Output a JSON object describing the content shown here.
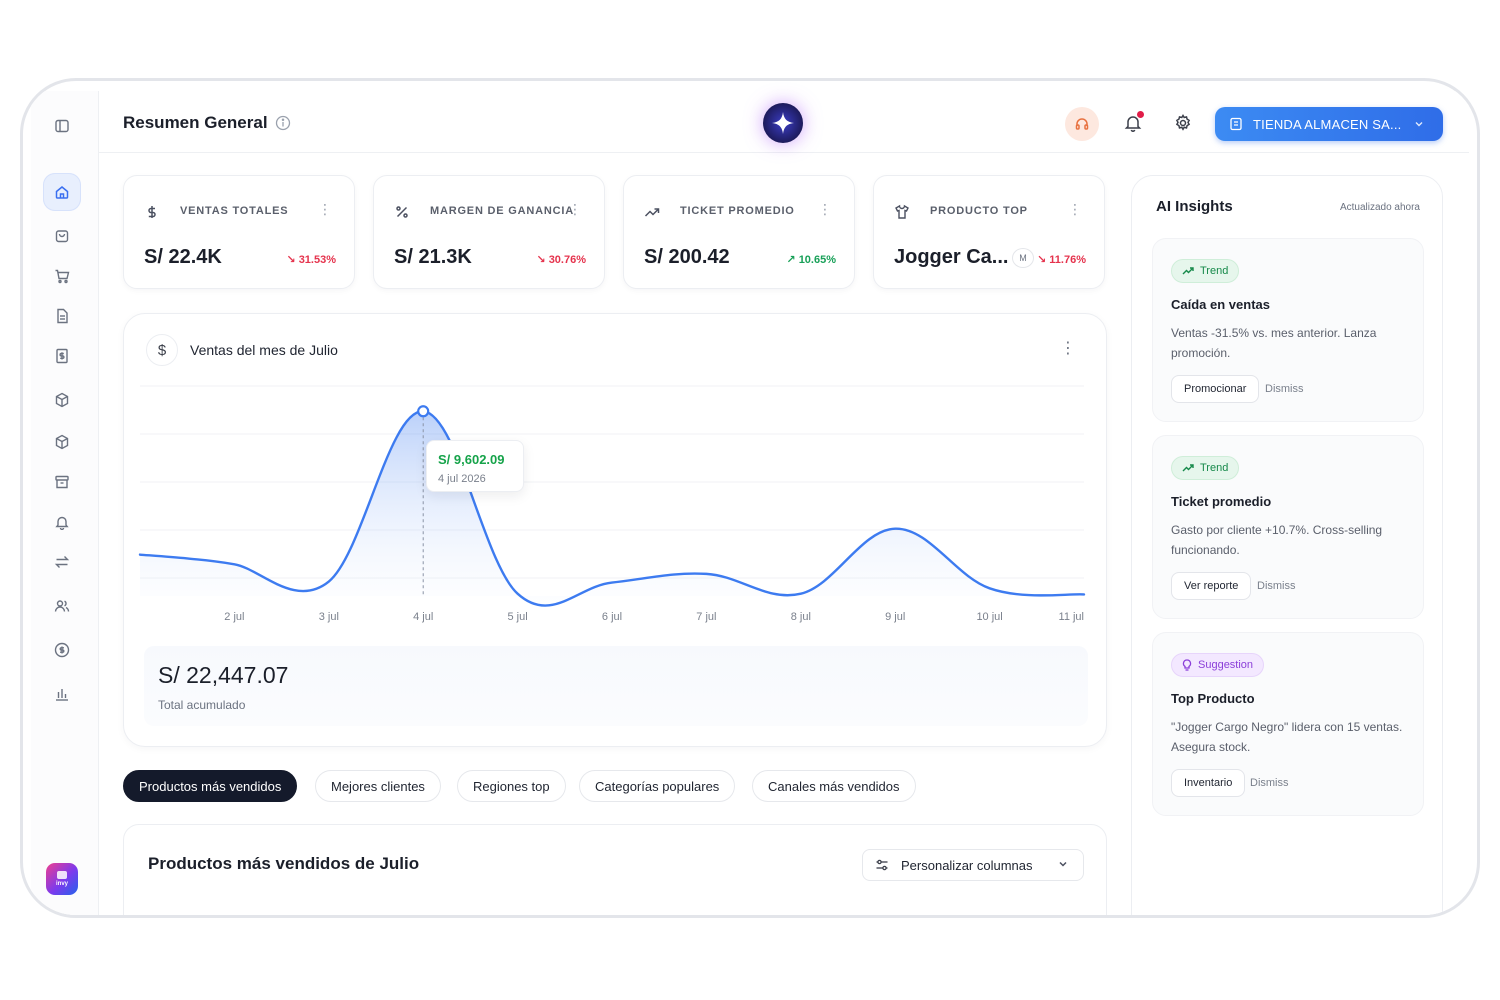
{
  "header": {
    "title": "Resumen General",
    "store_label": "TIENDA ALMACEN SA..."
  },
  "sidebar": {
    "items": [
      {
        "icon": "home-icon",
        "active": true
      },
      {
        "icon": "bag-icon"
      },
      {
        "icon": "cart-icon"
      },
      {
        "icon": "document-icon"
      },
      {
        "icon": "invoice-icon"
      },
      {
        "icon": "box-icon"
      },
      {
        "icon": "package-icon"
      },
      {
        "icon": "archive-icon"
      },
      {
        "icon": "bell-icon"
      },
      {
        "icon": "transfer-icon"
      },
      {
        "icon": "users-icon"
      },
      {
        "icon": "coin-icon"
      },
      {
        "icon": "bar-chart-icon"
      }
    ],
    "logo_text": "invy"
  },
  "kpis": [
    {
      "icon": "dollar-icon",
      "label": "VENTAS TOTALES",
      "value": "S/ 22.4K",
      "delta": "31.53%",
      "direction": "down"
    },
    {
      "icon": "percent-icon",
      "label": "MARGEN DE GANANCIA",
      "value": "S/ 21.3K",
      "delta": "30.76%",
      "direction": "down"
    },
    {
      "icon": "trend-up-icon",
      "label": "TICKET PROMEDIO",
      "value": "S/ 200.42",
      "delta": "10.65%",
      "direction": "up"
    },
    {
      "icon": "shirt-icon",
      "label": "PRODUCTO TOP",
      "value": "Jogger Ca...",
      "tag": "M",
      "delta": "11.76%",
      "direction": "down"
    }
  ],
  "chart": {
    "title": "Ventas del mes de Julio",
    "tooltip": {
      "amount": "S/ 9,602.09",
      "date": "4 jul 2026"
    },
    "total_value": "S/ 22,447.07",
    "total_label": "Total acumulado"
  },
  "chart_data": {
    "type": "area",
    "title": "Ventas del mes de Julio",
    "categories": [
      "2 jul",
      "3 jul",
      "4 jul",
      "5 jul",
      "6 jul",
      "7 jul",
      "8 jul",
      "9 jul",
      "10 jul",
      "11 jul"
    ],
    "x": [
      1,
      1.5,
      2,
      3,
      4,
      5,
      6,
      7,
      8,
      9,
      10,
      11
    ],
    "y": [
      2150,
      1950,
      1650,
      750,
      9602.09,
      120,
      700,
      1150,
      120,
      3500,
      400,
      80
    ],
    "ylim": [
      0,
      10500
    ],
    "grid": true,
    "colors": {
      "line": "#3d7bf0",
      "fill": "#dbe7fd"
    }
  },
  "tabs": [
    {
      "label": "Productos más vendidos",
      "active": true
    },
    {
      "label": "Mejores clientes"
    },
    {
      "label": "Regiones top"
    },
    {
      "label": "Categorías populares"
    },
    {
      "label": "Canales más vendidos"
    }
  ],
  "table": {
    "title": "Productos más vendidos de Julio",
    "customize_label": "Personalizar columnas"
  },
  "insights": {
    "title": "AI Insights",
    "updated": "Actualizado ahora",
    "cards": [
      {
        "badge": "Trend",
        "kind": "trend",
        "heading": "Caída en ventas",
        "body": "Ventas -31.5% vs. mes anterior. Lanza promoción.",
        "action": "Promocionar",
        "dismiss": "Dismiss"
      },
      {
        "badge": "Trend",
        "kind": "trend",
        "heading": "Ticket promedio",
        "body": "Gasto por cliente +10.7%. Cross-selling funcionando.",
        "action": "Ver reporte",
        "dismiss": "Dismiss"
      },
      {
        "badge": "Suggestion",
        "kind": "suggest",
        "heading": "Top Producto",
        "body": "\"Jogger Cargo Negro\" lidera con 15 ventas. Asegura stock.",
        "action": "Inventario",
        "dismiss": "Dismiss"
      }
    ]
  },
  "colors": {
    "accent": "#2f6de8",
    "dark": "#141a2b",
    "negative": "#e5334d",
    "positive": "#18a058"
  }
}
